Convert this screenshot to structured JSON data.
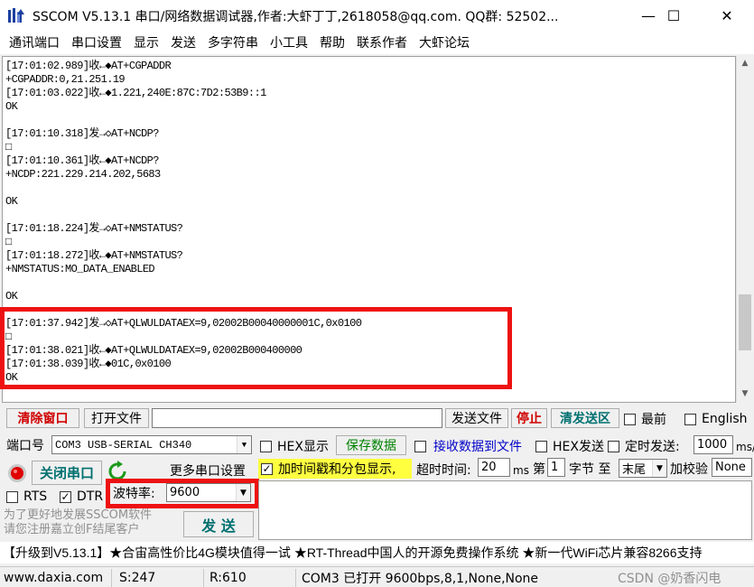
{
  "window": {
    "title": "SSCOM V5.13.1 串口/网络数据调试器,作者:大虾丁丁,2618058@qq.com. QQ群: 52502...",
    "minimize": "—",
    "maximize": "☐",
    "close": "✕"
  },
  "menu": [
    "通讯端口",
    "串口设置",
    "显示",
    "发送",
    "多字符串",
    "小工具",
    "帮助",
    "联系作者",
    "大虾论坛"
  ],
  "receive_lines": [
    "[17:01:02.989]收←◆AT+CGPADDR",
    "+CGPADDR:0,21.251.19",
    "[17:01:03.022]收←◆1.221,240E:87C:7D2:53B9::1",
    "OK",
    "",
    "[17:01:10.318]发→◇AT+NCDP?",
    "□",
    "[17:01:10.361]收←◆AT+NCDP?",
    "+NCDP:221.229.214.202,5683",
    "",
    "OK",
    "",
    "[17:01:18.224]发→◇AT+NMSTATUS?",
    "□",
    "[17:01:18.272]收←◆AT+NMSTATUS?",
    "+NMSTATUS:MO_DATA_ENABLED",
    "",
    "OK",
    "",
    "[17:01:37.942]发→◇AT+QLWULDATAEX=9,02002B00040000001C,0x0100",
    "□",
    "[17:01:38.021]收←◆AT+QLWULDATAEX=9,02002B000400000",
    "[17:01:38.039]收←◆01C,0x0100",
    "OK"
  ],
  "toolbar1": {
    "clear": "清除窗口",
    "open_file": "打开文件",
    "file_path": "",
    "send_file": "发送文件",
    "stop": "停止",
    "clear_send": "清发送区",
    "front": "最前",
    "english": "English"
  },
  "row2": {
    "port_label": "端口号",
    "port_value": "COM3 USB-SERIAL CH340",
    "hex_show": "HEX显示",
    "save_data": "保存数据",
    "recv_to_file": "接收数据到文件",
    "hex_send": "HEX发送",
    "timed_send": "定时发送:",
    "interval": "1000",
    "interval_unit": "ms/次"
  },
  "row3": {
    "close_port": "关闭串口",
    "more_settings": "更多串口设置",
    "timestamp": "加时间戳和分包显示,",
    "timeout_label": "超时时间:",
    "timeout": "20",
    "timeout_unit": "ms",
    "byte_label_pre": "第",
    "byte_index": "1",
    "byte_label_mid": "字节 至",
    "byte_end": "末尾",
    "checksum_label": "加校验",
    "checksum": "None"
  },
  "row4": {
    "rts": "RTS",
    "dtr": "DTR",
    "baud_label": "波特率:",
    "baud": "9600"
  },
  "send": {
    "promo": "为了更好地发展SSCOM软件\n请您注册嘉立创F结尾客户",
    "button": "发 送"
  },
  "ticker": "【升级到V5.13.1】★合宙高性价比4G模块值得一试 ★RT-Thread中国人的开源免费操作系统 ★新一代WiFi芯片兼容8266支持",
  "status": {
    "website": "www.daxia.com",
    "sent": "S:247",
    "received": "R:610",
    "port_state": "COM3 已打开  9600bps,8,1,None,None",
    "watermark": "CSDN @奶香闪电"
  },
  "colors": {
    "highlight": "#ee1111",
    "status_red": "#d00000",
    "timestamp_bg": "#ffff40"
  }
}
